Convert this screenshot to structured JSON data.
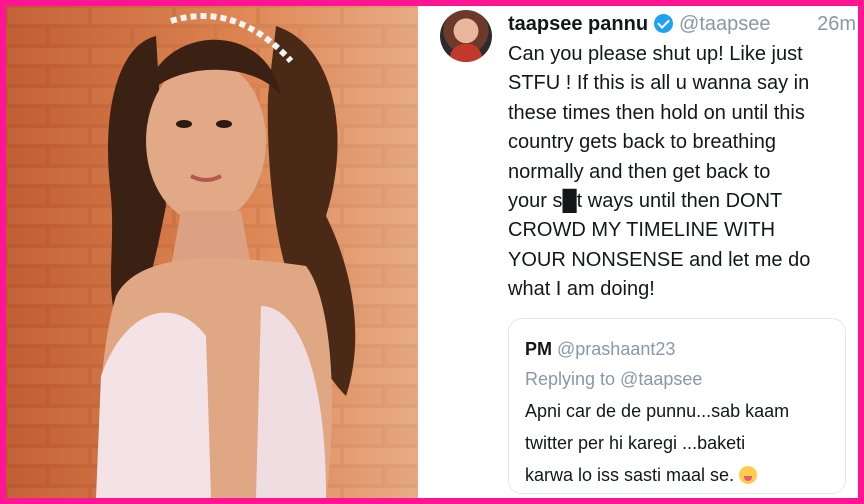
{
  "tweet": {
    "display_name": "taapsee pannu",
    "handle": "@taapsee",
    "time": "26m",
    "verified_icon": "verified-badge-icon",
    "text": "Can you please shut up! Like just\nSTFU ! If this is all u wanna say in\nthese times then hold on until this\ncountry gets back to breathing\nnormally and then get back to\nyour s█t ways until then DONT\nCROWD MY TIMELINE WITH\nYOUR NONSENSE and let me do\nwhat I am doing!"
  },
  "quoted_tweet": {
    "name": "PM",
    "handle": "@prashaant23",
    "replying_to": "Replying to @taapsee",
    "text": "Apni car de de punnu...sab kaam\ntwitter per hi karegi ...baketi\nkarwa lo iss sasti maal se. ",
    "emoji_icon": "grinning-tongue-emoji-icon"
  },
  "colors": {
    "border": "#ff1493",
    "verified": "#1da1f2",
    "muted": "#8899a6",
    "text": "#14171a"
  }
}
